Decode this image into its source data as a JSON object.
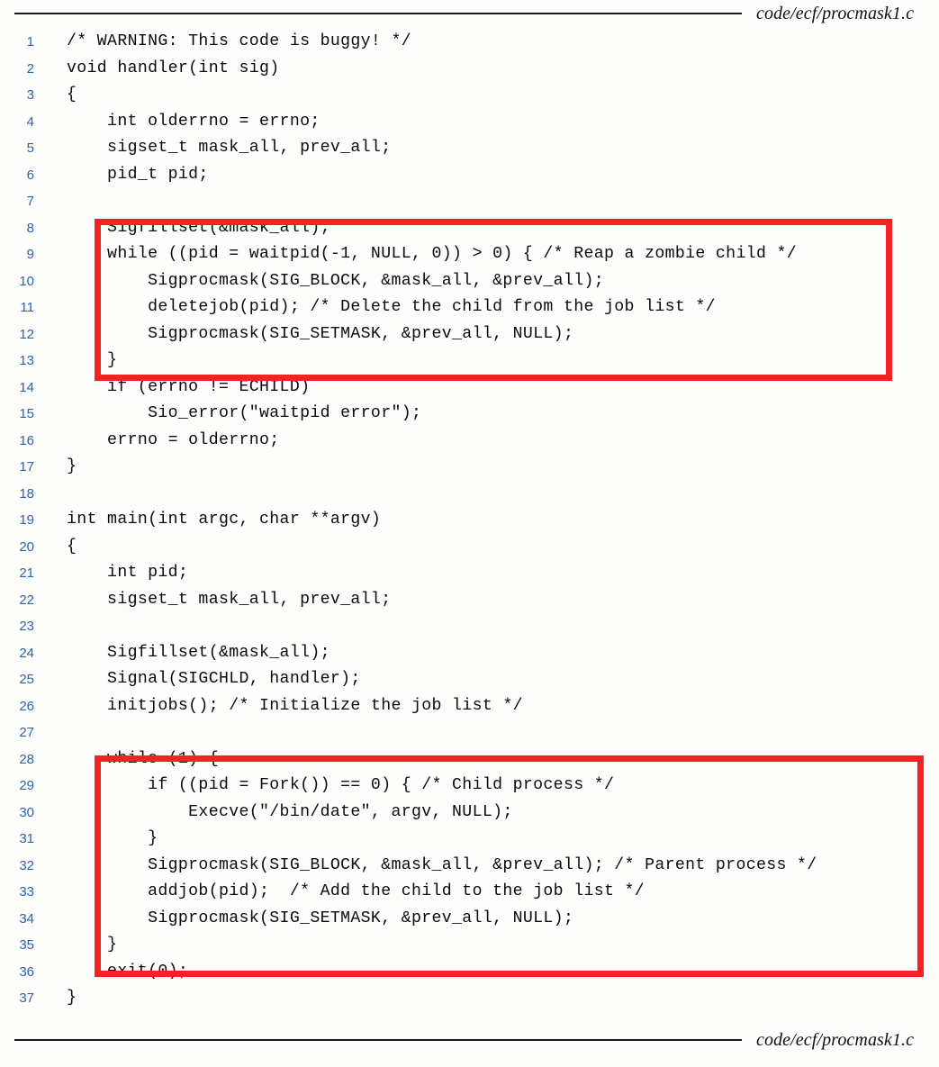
{
  "header": {
    "caption": "code/ecf/procmask1.c",
    "rule": "horizontal-rule"
  },
  "footer": {
    "caption": "code/ecf/procmask1.c",
    "rule": "horizontal-rule"
  },
  "colors": {
    "line_number": "#2d62ad",
    "code_text": "#0b0b0b",
    "highlight_border": "#f42222",
    "page_background": "#fdfdfb",
    "rule": "#1a1a1a"
  },
  "listing": {
    "language": "c",
    "file": "procmask1.c",
    "lines": [
      {
        "n": "1",
        "text": "/* WARNING: This code is buggy! */"
      },
      {
        "n": "2",
        "text": "void handler(int sig)"
      },
      {
        "n": "3",
        "text": "{"
      },
      {
        "n": "4",
        "text": "    int olderrno = errno;"
      },
      {
        "n": "5",
        "text": "    sigset_t mask_all, prev_all;"
      },
      {
        "n": "6",
        "text": "    pid_t pid;"
      },
      {
        "n": "7",
        "text": ""
      },
      {
        "n": "8",
        "text": "    Sigfillset(&mask_all);"
      },
      {
        "n": "9",
        "text": "    while ((pid = waitpid(-1, NULL, 0)) > 0) { /* Reap a zombie child */"
      },
      {
        "n": "10",
        "text": "        Sigprocmask(SIG_BLOCK, &mask_all, &prev_all);"
      },
      {
        "n": "11",
        "text": "        deletejob(pid); /* Delete the child from the job list */"
      },
      {
        "n": "12",
        "text": "        Sigprocmask(SIG_SETMASK, &prev_all, NULL);"
      },
      {
        "n": "13",
        "text": "    }"
      },
      {
        "n": "14",
        "text": "    if (errno != ECHILD)"
      },
      {
        "n": "15",
        "text": "        Sio_error(\"waitpid error\");"
      },
      {
        "n": "16",
        "text": "    errno = olderrno;"
      },
      {
        "n": "17",
        "text": "}"
      },
      {
        "n": "18",
        "text": ""
      },
      {
        "n": "19",
        "text": "int main(int argc, char **argv)"
      },
      {
        "n": "20",
        "text": "{"
      },
      {
        "n": "21",
        "text": "    int pid;"
      },
      {
        "n": "22",
        "text": "    sigset_t mask_all, prev_all;"
      },
      {
        "n": "23",
        "text": ""
      },
      {
        "n": "24",
        "text": "    Sigfillset(&mask_all);"
      },
      {
        "n": "25",
        "text": "    Signal(SIGCHLD, handler);"
      },
      {
        "n": "26",
        "text": "    initjobs(); /* Initialize the job list */"
      },
      {
        "n": "27",
        "text": ""
      },
      {
        "n": "28",
        "text": "    while (1) {"
      },
      {
        "n": "29",
        "text": "        if ((pid = Fork()) == 0) { /* Child process */"
      },
      {
        "n": "30",
        "text": "            Execve(\"/bin/date\", argv, NULL);"
      },
      {
        "n": "31",
        "text": "        }"
      },
      {
        "n": "32",
        "text": "        Sigprocmask(SIG_BLOCK, &mask_all, &prev_all); /* Parent process */"
      },
      {
        "n": "33",
        "text": "        addjob(pid);  /* Add the child to the job list */"
      },
      {
        "n": "34",
        "text": "        Sigprocmask(SIG_SETMASK, &prev_all, NULL);"
      },
      {
        "n": "35",
        "text": "    }"
      },
      {
        "n": "36",
        "text": "    exit(0);"
      },
      {
        "n": "37",
        "text": "}"
      }
    ]
  },
  "highlights": [
    {
      "id": "hl-1",
      "first_line": "8",
      "last_line": "13",
      "color": "#f42222"
    },
    {
      "id": "hl-2",
      "id_label": "second",
      "first_line": "28",
      "last_line": "35",
      "color": "#f42222"
    }
  ]
}
